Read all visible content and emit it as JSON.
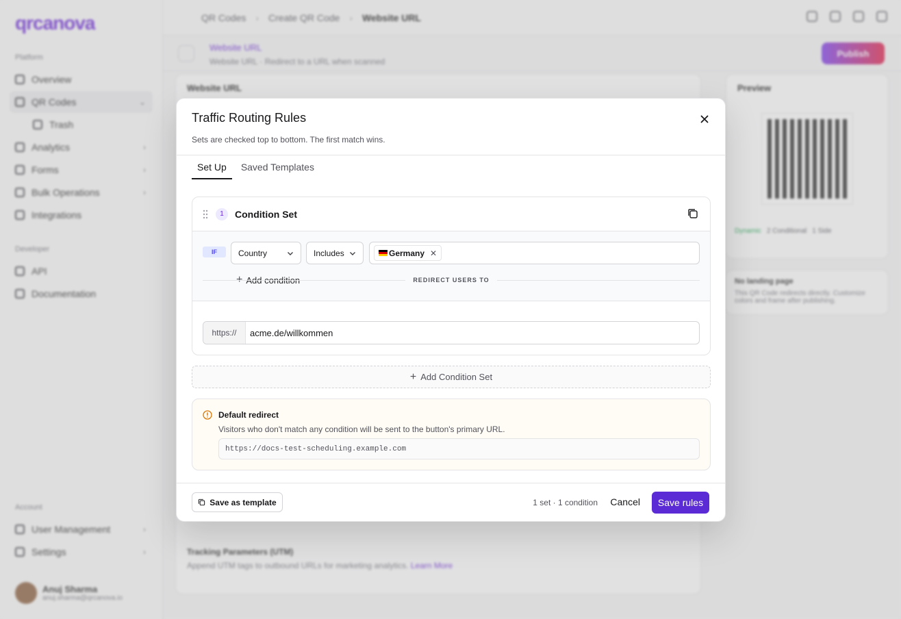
{
  "app": {
    "logo": "qrcanova",
    "sidebar": {
      "section_platform": "Platform",
      "items": [
        {
          "label": "Overview"
        },
        {
          "label": "QR Codes"
        },
        {
          "label": "Trash"
        },
        {
          "label": "Analytics"
        },
        {
          "label": "Forms"
        },
        {
          "label": "Bulk Operations"
        },
        {
          "label": "Integrations"
        }
      ],
      "section_developer": "Developer",
      "dev_items": [
        {
          "label": "API"
        },
        {
          "label": "Documentation"
        }
      ],
      "section_account": "Account",
      "account_items": [
        {
          "label": "User Management"
        },
        {
          "label": "Settings"
        }
      ],
      "user": {
        "name": "Anuj Sharma",
        "email": "anuj.sharma@qrcanova.io"
      }
    },
    "breadcrumb": [
      "QR Codes",
      "Create QR Code",
      "Website URL"
    ],
    "page_header": {
      "title": "Website URL",
      "subtitle": "Website URL · Redirect to a URL when scanned"
    },
    "publish_label": "Publish",
    "left_card_title": "Website URL",
    "utm": {
      "title": "Tracking Parameters (UTM)",
      "desc": "Append UTM tags to outbound URLs for marketing analytics.",
      "link": "Learn More"
    },
    "preview": {
      "title": "Preview",
      "chips": [
        "Dynamic",
        "2 Conditional",
        "1 Side"
      ],
      "no_landing_title": "No landing page",
      "no_landing_desc": "This QR Code redirects directly. Customize colors and frame after publishing."
    }
  },
  "modal": {
    "title": "Traffic Routing Rules",
    "subtitle": "Sets are checked top to bottom. The first match wins.",
    "tabs": [
      {
        "label": "Set Up",
        "active": true
      },
      {
        "label": "Saved Templates",
        "active": false
      }
    ],
    "condition_set": {
      "number": "1",
      "title": "Condition Set",
      "if_label": "IF",
      "field": "Country",
      "operator": "Includes",
      "value_chip": "Germany",
      "add_condition": "Add condition",
      "redirect_label": "REDIRECT USERS TO",
      "url_prefix": "https://",
      "url_value": "acme.de/willkommen"
    },
    "add_condition_set": "Add Condition Set",
    "default_redirect": {
      "title": "Default redirect",
      "desc": "Visitors who don't match any condition will be sent to the button's primary URL.",
      "url": "https://docs-test-scheduling.example.com"
    },
    "footer": {
      "save_template": "Save as template",
      "summary": "1 set · 1 condition",
      "cancel": "Cancel",
      "save": "Save rules"
    }
  },
  "colors": {
    "accent": "#5b2bd6",
    "flag_black": "#000000",
    "flag_red": "#dd0000",
    "flag_gold": "#ffce00"
  }
}
